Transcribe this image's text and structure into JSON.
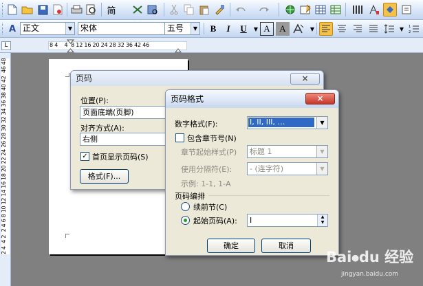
{
  "toolbar1": {
    "icons": [
      "new-doc-icon",
      "open-icon",
      "save-icon",
      "permission-icon",
      "print-icon",
      "print-preview-icon",
      "spelling-icon",
      "research-icon",
      "cut-icon",
      "copy-icon",
      "paste-icon",
      "format-painter-icon",
      "undo-icon",
      "redo-icon",
      "hyperlink-icon",
      "tables-borders-icon",
      "insert-table-icon",
      "insert-excel-icon",
      "columns-icon",
      "drawing-icon",
      "docmap-icon",
      "show-hide-icon"
    ],
    "font_size_glyph": "简"
  },
  "toolbar2": {
    "styles_icon": "A",
    "style_value": "正文",
    "font_value": "宋体",
    "size_value": "五号",
    "bold": "B",
    "italic": "I",
    "underline": "U",
    "char_border": "A",
    "char_shading": "A"
  },
  "ruler": {
    "corner": "L",
    "horizontal": "8 4    4  8 12 16 20 24 28 32 36 42 46",
    "vertical": "2 4  4 2  2 4 6 8 10 12 14 16 18 20 22 24 26 28 30 32 34 36 38 40 42  46 48"
  },
  "page_number_dialog": {
    "title": "页码",
    "position_label": "位置(P):",
    "position_value": "页面底端(页脚)",
    "alignment_label": "对齐方式(A):",
    "alignment_value": "右侧",
    "first_page_label": "首页显示页码(S)",
    "first_page_checked": true,
    "format_button": "格式(F)...",
    "close": "×"
  },
  "page_format_dialog": {
    "title": "页码格式",
    "close": "×",
    "number_format_label": "数字格式(F):",
    "number_format_value": "I, II, III, …",
    "include_chapter_label": "包含章节号(N)",
    "include_chapter_checked": false,
    "chapter_style_label": "章节起始样式(P)",
    "chapter_style_value": "标题 1",
    "separator_label": "使用分隔符(E):",
    "separator_value": "-  (连字符)",
    "example_label": "示例:  1-1, 1-A",
    "numbering_group": "页码编排",
    "continue_label": "续前节(C)",
    "start_at_label": "起始页码(A):",
    "start_at_value": "I",
    "start_at_selected": true,
    "ok_button": "确定",
    "cancel_button": "取消"
  },
  "watermark": {
    "logo": "Bai⦁du 经验",
    "url": "jingyan.baidu.com"
  }
}
